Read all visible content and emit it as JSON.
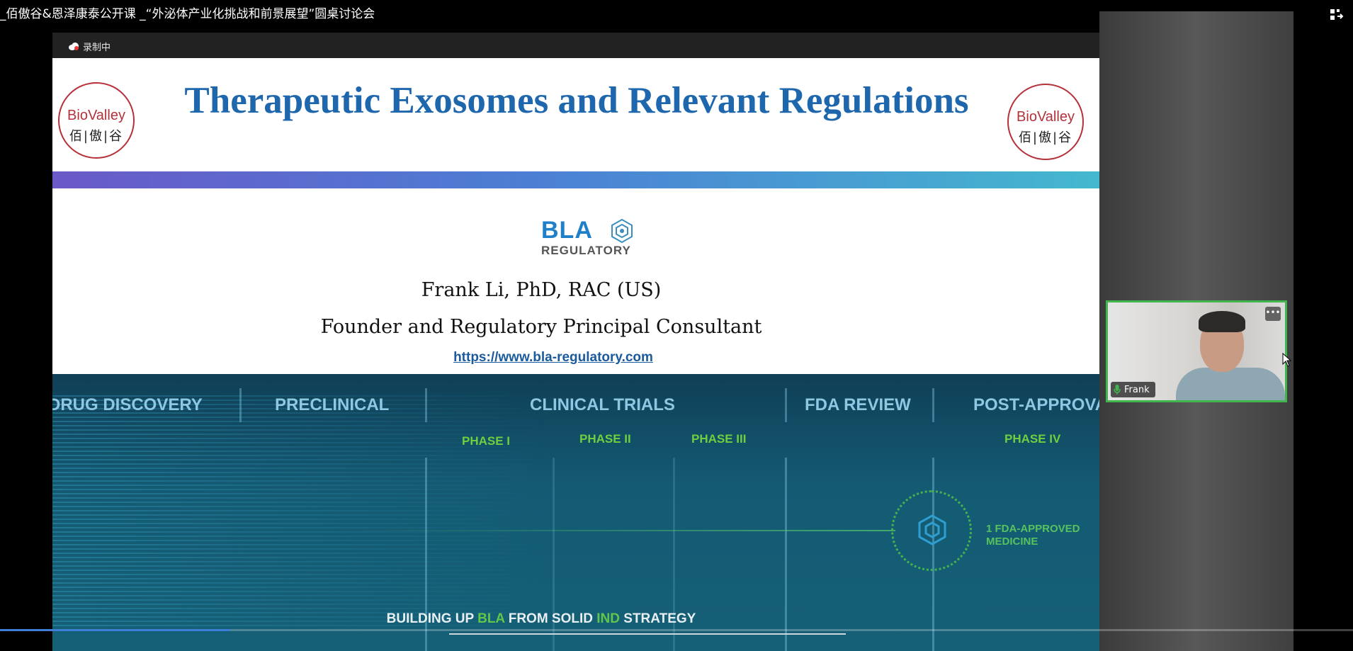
{
  "window": {
    "title": "_佰傲谷&恩泽康泰公开课 _“外泌体产业化挑战和前景展望”圆桌讨论会"
  },
  "meeting": {
    "recording_label": "录制中"
  },
  "slide": {
    "title": "Therapeutic Exosomes and Relevant Regulations",
    "logo": {
      "name_en": "BioValley",
      "name_cn": "佰|傲|谷"
    },
    "company_logo": {
      "main": "BLA",
      "sub": "REGULATORY"
    },
    "presenter_name": "Frank Li, PhD, RAC (US)",
    "presenter_role": "Founder and Regulatory Principal Consultant",
    "presenter_url": "https://www.bla-regulatory.com",
    "pipeline": {
      "stages": [
        "DRUG DISCOVERY",
        "PRECLINICAL",
        "CLINICAL TRIALS",
        "FDA REVIEW",
        "POST-APPROVAL"
      ],
      "phases": [
        "PHASE I",
        "PHASE II",
        "PHASE III",
        "PHASE IV"
      ],
      "approval_note_line1": "1 FDA-APPROVED",
      "approval_note_line2": "MEDICINE",
      "tagline_part1": "BUILDING UP ",
      "tagline_bla": "BLA",
      "tagline_part2": " FROM SOLID ",
      "tagline_ind": "IND",
      "tagline_part3": " STRATEGY"
    }
  },
  "participant": {
    "name": "Frank",
    "mic_icon": "microphone-icon",
    "more_icon": "ellipsis-icon",
    "active_speaker_color": "#41b64f"
  },
  "playback": {
    "progress_fraction": 0.17
  },
  "colors": {
    "title_blue": "#1f67ad",
    "logo_red": "#b5313a",
    "phase_green": "#6fcf3f"
  }
}
